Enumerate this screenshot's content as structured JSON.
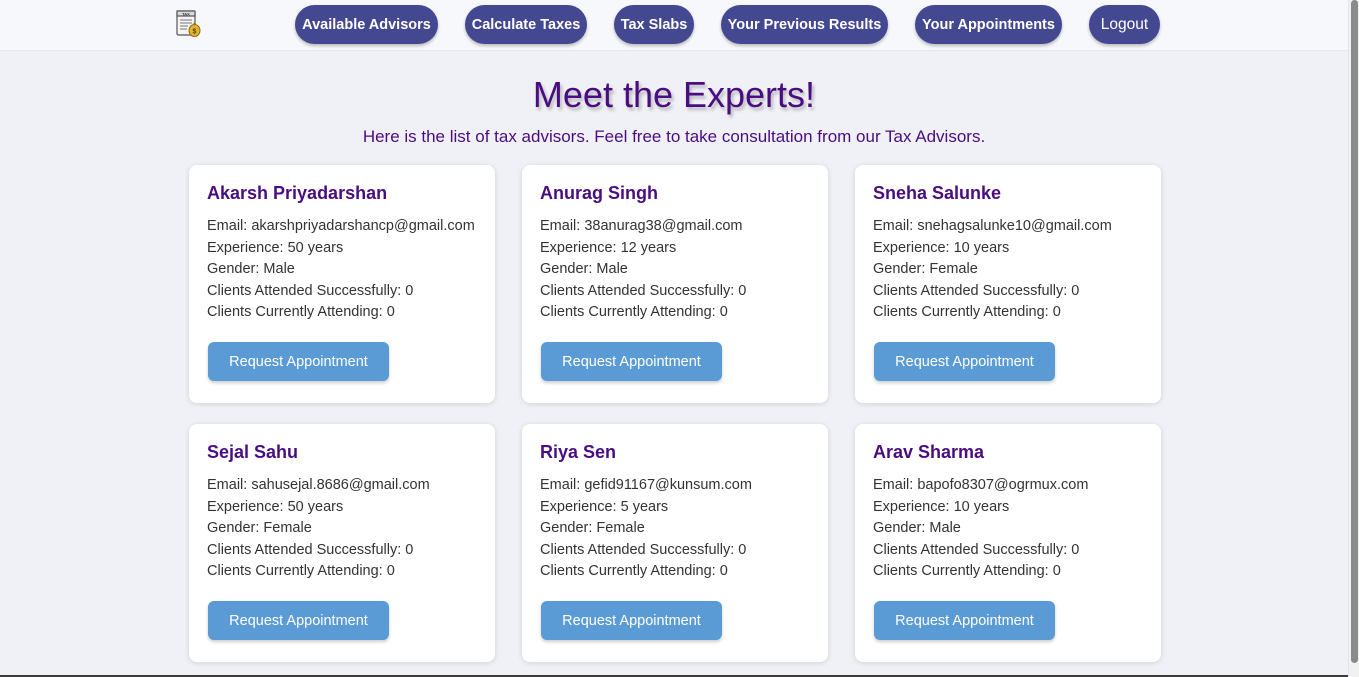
{
  "nav": {
    "logo_icon": "tax-document-money-bag-icon",
    "buttons": [
      "Available Advisors",
      "Calculate Taxes",
      "Tax Slabs",
      "Your Previous Results",
      "Your Appointments",
      "Logout"
    ],
    "colors": {
      "button_bg": "#444891",
      "button_text": "#ffffff"
    }
  },
  "header": {
    "title": "Meet the Experts!",
    "subtitle": "Here is the list of tax advisors. Feel free to take consultation from our Tax Advisors."
  },
  "advisors": [
    {
      "name": "Akarsh Priyadarshan",
      "email": "Email: akarshpriyadarshancp@gmail.com",
      "experience": "Experience: 50 years",
      "gender": "Gender: Male",
      "attended": "Clients Attended Successfully: 0",
      "attending": "Clients Currently Attending: 0",
      "button": "Request Appointment"
    },
    {
      "name": "Anurag Singh",
      "email": "Email: 38anurag38@gmail.com",
      "experience": "Experience: 12 years",
      "gender": "Gender: Male",
      "attended": "Clients Attended Successfully: 0",
      "attending": "Clients Currently Attending: 0",
      "button": "Request Appointment"
    },
    {
      "name": "Sneha Salunke",
      "email": "Email: snehagsalunke10@gmail.com",
      "experience": "Experience: 10 years",
      "gender": "Gender: Female",
      "attended": "Clients Attended Successfully: 0",
      "attending": "Clients Currently Attending: 0",
      "button": "Request Appointment"
    },
    {
      "name": "Sejal Sahu",
      "email": "Email: sahusejal.8686@gmail.com",
      "experience": "Experience: 50 years",
      "gender": "Gender: Female",
      "attended": "Clients Attended Successfully: 0",
      "attending": "Clients Currently Attending: 0",
      "button": "Request Appointment"
    },
    {
      "name": "Riya Sen",
      "email": "Email: gefid91167@kunsum.com",
      "experience": "Experience: 5 years",
      "gender": "Gender: Female",
      "attended": "Clients Attended Successfully: 0",
      "attending": "Clients Currently Attending: 0",
      "button": "Request Appointment"
    },
    {
      "name": "Arav Sharma",
      "email": "Email: bapofo8307@ogrmux.com",
      "experience": "Experience: 10 years",
      "gender": "Gender: Male",
      "attended": "Clients Attended Successfully: 0",
      "attending": "Clients Currently Attending: 0",
      "button": "Request Appointment"
    }
  ],
  "colors": {
    "title": "#4a0d80",
    "request_button": "#5b9bd5",
    "page_bg": "#f0f1f6"
  }
}
